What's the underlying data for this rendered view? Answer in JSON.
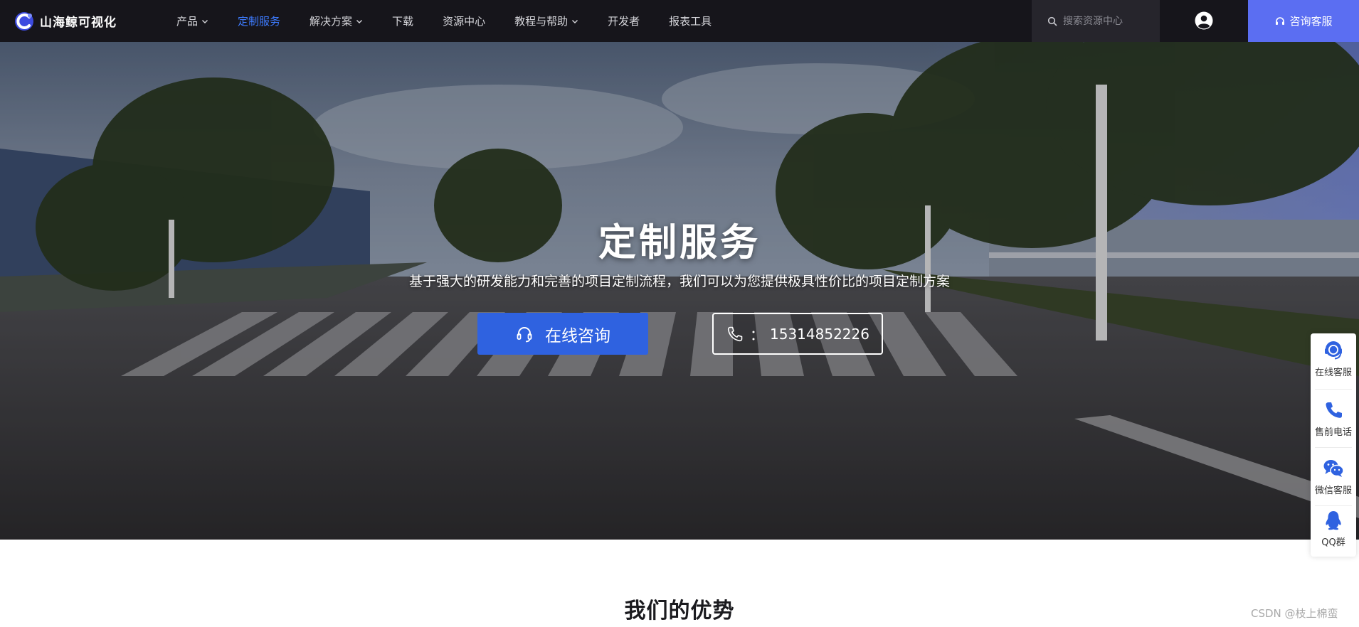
{
  "brand": {
    "logo_text": "山海鲸可视化",
    "accent": "#3d7bff"
  },
  "nav": {
    "items": [
      {
        "label": "产品",
        "has_dropdown": true,
        "active": false
      },
      {
        "label": "定制服务",
        "has_dropdown": false,
        "active": true
      },
      {
        "label": "解决方案",
        "has_dropdown": true,
        "active": false
      },
      {
        "label": "下载",
        "has_dropdown": false,
        "active": false
      },
      {
        "label": "资源中心",
        "has_dropdown": false,
        "active": false
      },
      {
        "label": "教程与帮助",
        "has_dropdown": true,
        "active": false
      },
      {
        "label": "开发者",
        "has_dropdown": false,
        "active": false
      },
      {
        "label": "报表工具",
        "has_dropdown": false,
        "active": false
      }
    ]
  },
  "search": {
    "placeholder": "搜索资源中心",
    "icon": "search-icon"
  },
  "header": {
    "consult_label": "咨询客服",
    "consult_color": "#5b6ef2"
  },
  "hero": {
    "title": "定制服务",
    "subtitle": "基于强大的研发能力和完善的项目定制流程，我们可以为您提供极具性价比的项目定制方案",
    "online_button": "在线咨询",
    "phone_prefix": "：",
    "phone_number": "15314852226",
    "button_color": "#2f62e0"
  },
  "section": {
    "title": "我们的优势"
  },
  "float_bar": {
    "items": [
      {
        "label": "在线客服",
        "icon": "headset-icon"
      },
      {
        "label": "售前电话",
        "icon": "phone-icon"
      },
      {
        "label": "微信客服",
        "icon": "wechat-icon"
      },
      {
        "label": "QQ群",
        "icon": "qq-icon"
      }
    ],
    "icon_color": "#2f62e0"
  },
  "watermark": "CSDN @枝上棉蛮"
}
